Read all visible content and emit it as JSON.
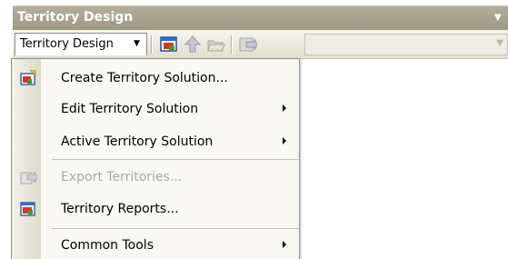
{
  "window": {
    "title": "Territory Design"
  },
  "toolbar": {
    "menu_button_label": "Territory Design",
    "menu_button_arrow": "▼",
    "buttons": [
      {
        "icon": "territory-solution-icon"
      },
      {
        "icon": "up-arrow-icon"
      },
      {
        "icon": "open-folder-icon"
      },
      {
        "icon": "export-icon"
      }
    ],
    "combo_value": ""
  },
  "menu": {
    "items": [
      {
        "label": "Create Territory Solution...",
        "icon": "create-solution-icon",
        "submenu": false,
        "enabled": true
      },
      {
        "label": "Edit Territory Solution",
        "icon": "",
        "submenu": true,
        "enabled": true
      },
      {
        "label": "Active Territory Solution",
        "icon": "",
        "submenu": true,
        "enabled": true
      },
      {
        "label": "Export Territories...",
        "icon": "export-territories-icon",
        "submenu": false,
        "enabled": false
      },
      {
        "label": "Territory Reports...",
        "icon": "territory-reports-icon",
        "submenu": false,
        "enabled": true
      },
      {
        "label": "Common Tools",
        "icon": "",
        "submenu": true,
        "enabled": true
      }
    ]
  },
  "colors": {
    "title_bar": "#a8a28f",
    "menu_background": "#f9f8f3",
    "disabled_text": "#a8a8a0"
  }
}
